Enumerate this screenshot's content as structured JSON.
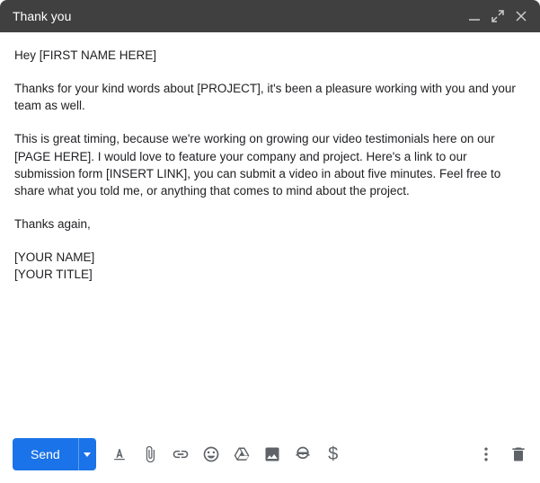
{
  "window": {
    "subject": "Thank you"
  },
  "body": {
    "greeting": "Hey [FIRST NAME HERE]",
    "p1": "Thanks for your kind words about [PROJECT], it's been a pleasure working with you and your team as well.",
    "p2": "This is great timing, because we're working on growing our video testimonials here on our [PAGE HERE]. I would love to feature your company and project. Here's a link to our submission form [INSERT LINK], you can submit a video in about five minutes. Feel free to share what you told me, or anything that comes to mind about the project.",
    "closing": "Thanks again,",
    "sig_name": "[YOUR NAME]",
    "sig_title": "[YOUR TITLE]"
  },
  "toolbar": {
    "send_label": "Send"
  }
}
